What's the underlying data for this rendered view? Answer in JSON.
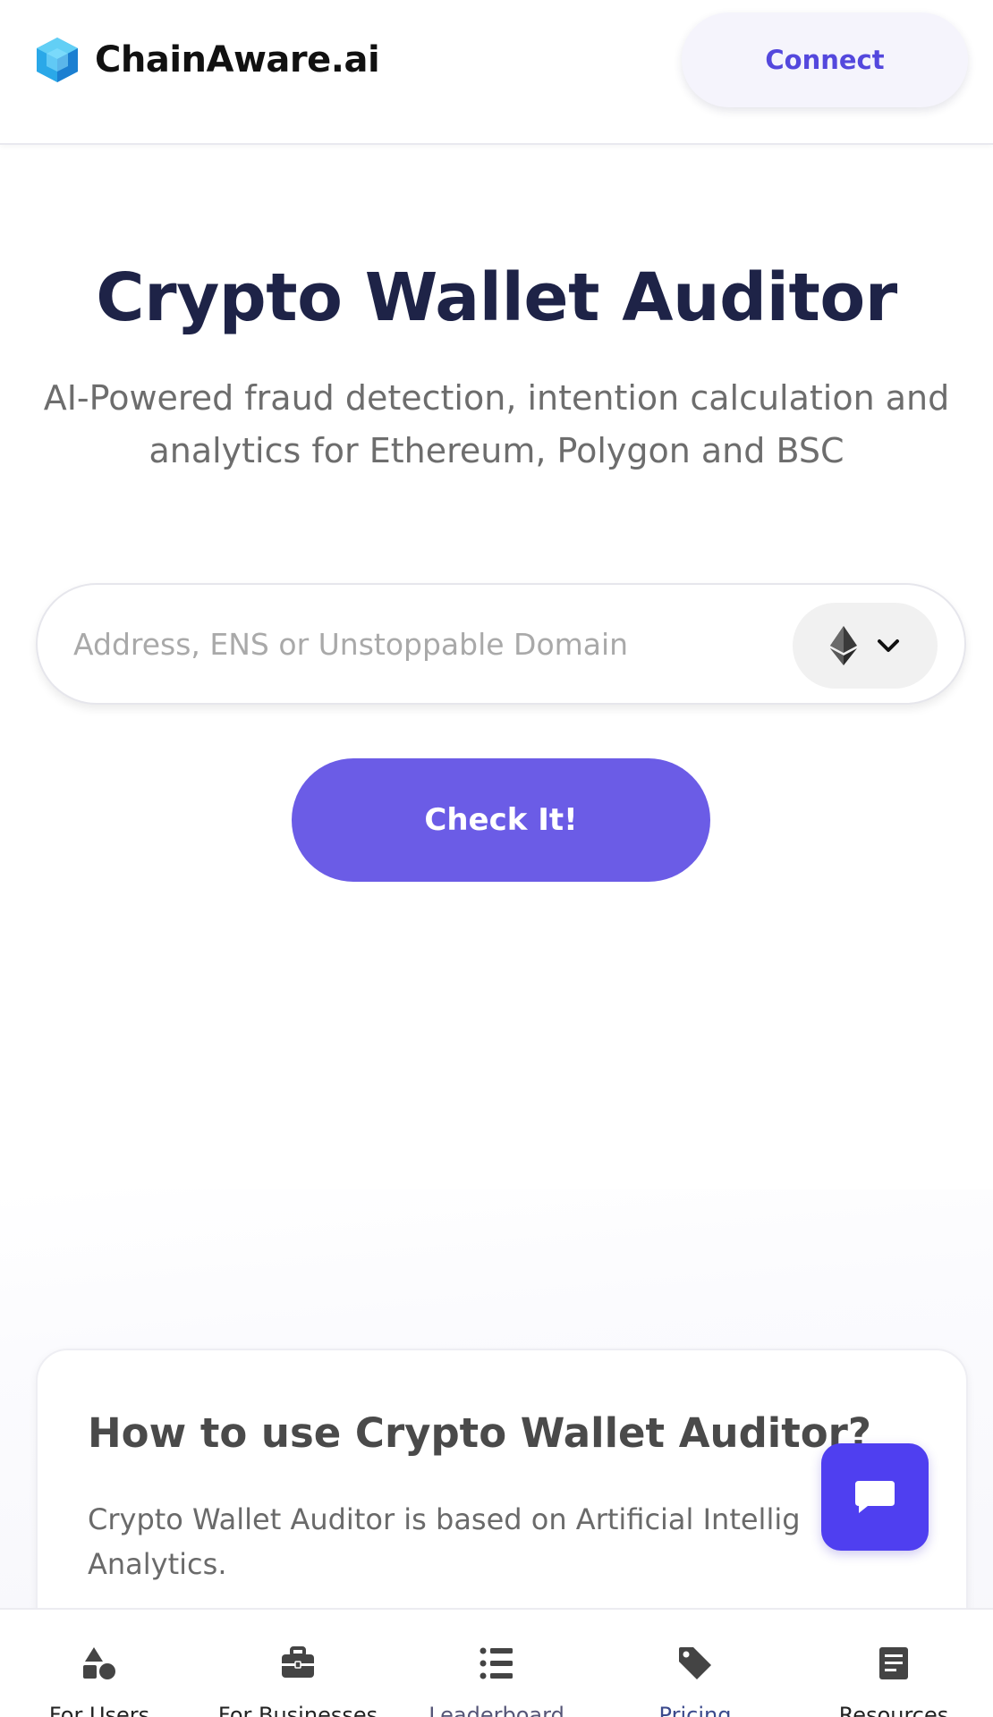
{
  "header": {
    "brand": "ChainAware.ai",
    "logo_icon": "cube-logo-icon",
    "connect_label": "Connect"
  },
  "hero": {
    "title": "Crypto Wallet Auditor",
    "subtitle": "AI-Powered fraud detection, intention calculation and analytics for Ethereum, Polygon and BSC"
  },
  "search": {
    "placeholder": "Address, ENS or Unstoppable Domain",
    "value": "",
    "chain_icon": "ethereum-icon",
    "dropdown_icon": "chevron-down-icon"
  },
  "check_button": {
    "label": "Check It!"
  },
  "info_card": {
    "title": "How to use Crypto Wallet Auditor?",
    "text": "Crypto Wallet Auditor is based on Artificial Intellig Analytics."
  },
  "chat": {
    "icon": "chat-bubble-icon"
  },
  "bottom_nav": {
    "items": [
      {
        "label": "For Users",
        "icon": "shapes-icon"
      },
      {
        "label": "For Businesses",
        "icon": "briefcase-icon"
      },
      {
        "label": "Leaderboard",
        "icon": "list-icon"
      },
      {
        "label": "Pricing",
        "icon": "tag-icon"
      },
      {
        "label": "Resources",
        "icon": "document-icon"
      }
    ]
  },
  "colors": {
    "accent": "#6b5ce6",
    "title": "#1e2347",
    "chat": "#4f3ff0"
  }
}
